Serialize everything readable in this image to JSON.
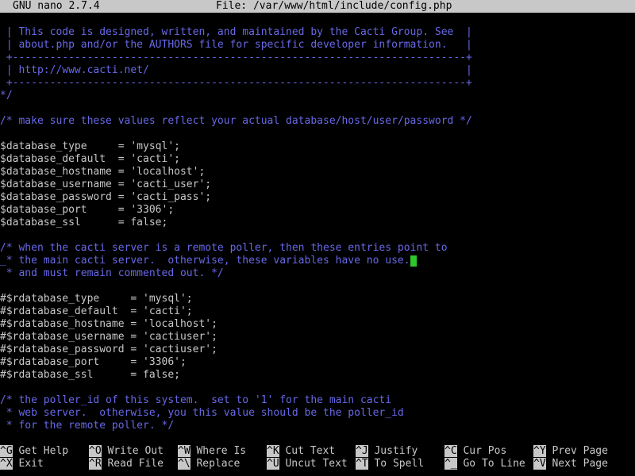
{
  "titlebar": {
    "app": "GNU nano 2.7.4",
    "file": "File: /var/www/html/include/config.php"
  },
  "colors": {
    "comment": "#6868e8",
    "code": "#c8c8c8",
    "cursor": "#2ec82e",
    "bar": "#c8c8c8"
  },
  "editor": {
    "lines": [
      " | This code is designed, written, and maintained by the Cacti Group. See  |",
      " | about.php and/or the AUTHORS file for specific developer information.   |",
      " +-------------------------------------------------------------------------+",
      " | http://www.cacti.net/                                                   |",
      " +-------------------------------------------------------------------------+",
      "*/",
      "",
      "/* make sure these values reflect your actual database/host/user/password */",
      "",
      "$database_type     = 'mysql';",
      "$database_default  = 'cacti';",
      "$database_hostname = 'localhost';",
      "$database_username = 'cacti_user';",
      "$database_password = 'cacti_pass';",
      "$database_port     = '3306';",
      "$database_ssl      = false;",
      "",
      "/* when the cacti server is a remote poller, then these entries point to",
      "_* the main cacti server.  otherwise, these variables have no use.",
      " * and must remain commented out. */",
      "",
      "#$rdatabase_type     = 'mysql';",
      "#$rdatabase_default  = 'cacti';",
      "#$rdatabase_hostname = 'localhost';",
      "#$rdatabase_username = 'cactiuser';",
      "#$rdatabase_password = 'cactiuser';",
      "#$rdatabase_port     = '3306';",
      "#$rdatabase_ssl      = false;",
      "",
      "/* the poller_id of this system.  set to '1' for the main cacti",
      " * web server.  otherwise, you this value should be the poller_id",
      " * for the remote poller. */"
    ],
    "line_styles": [
      "cmt",
      "cmt",
      "cmt",
      "cmt",
      "cmt",
      "cmt",
      "code",
      "cmt",
      "code",
      "code",
      "code",
      "code",
      "code",
      "code",
      "code",
      "code",
      "code",
      "cmt",
      "cmt",
      "cmt",
      "code",
      "code",
      "code",
      "code",
      "code",
      "code",
      "code",
      "code",
      "code",
      "cmt",
      "cmt",
      "cmt"
    ],
    "cursor_line": 18
  },
  "shortcuts": [
    [
      {
        "key": "^G",
        "label": "Get Help"
      },
      {
        "key": "^X",
        "label": "Exit"
      }
    ],
    [
      {
        "key": "^O",
        "label": "Write Out"
      },
      {
        "key": "^R",
        "label": "Read File"
      }
    ],
    [
      {
        "key": "^W",
        "label": "Where Is"
      },
      {
        "key": "^\\",
        "label": "Replace"
      }
    ],
    [
      {
        "key": "^K",
        "label": "Cut Text"
      },
      {
        "key": "^U",
        "label": "Uncut Text"
      }
    ],
    [
      {
        "key": "^J",
        "label": "Justify"
      },
      {
        "key": "^T",
        "label": "To Spell"
      }
    ],
    [
      {
        "key": "^C",
        "label": "Cur Pos"
      },
      {
        "key": "^_",
        "label": "Go To Line"
      }
    ],
    [
      {
        "key": "^Y",
        "label": "Prev Page"
      },
      {
        "key": "^V",
        "label": "Next Page"
      }
    ]
  ]
}
